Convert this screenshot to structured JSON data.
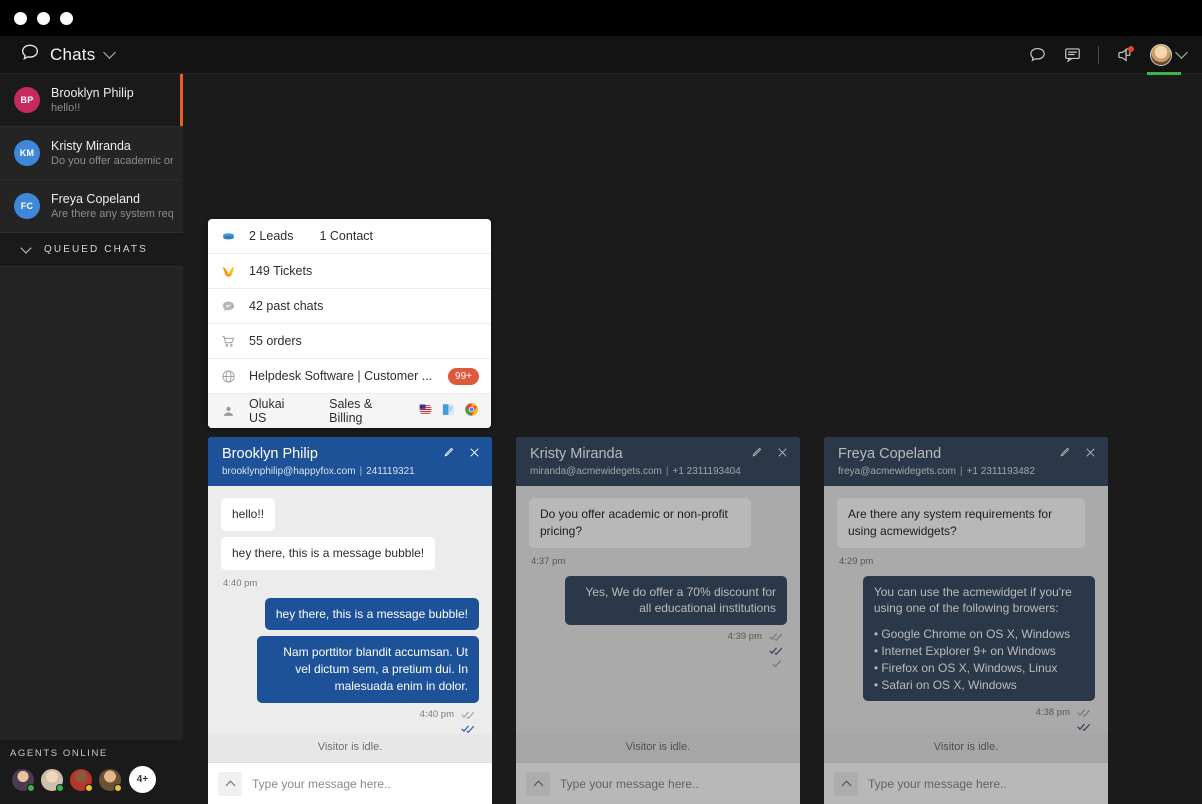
{
  "window": {
    "dots": 3
  },
  "header": {
    "title": "Chats",
    "chat_icon": "speech-bubble-icon",
    "dropdown_icon": "chevron-down-icon",
    "actions": [
      {
        "name": "conversations-icon",
        "glyph": "speech-bubble-outline-icon"
      },
      {
        "name": "messages-icon",
        "glyph": "message-lines-icon"
      },
      {
        "name": "announcements-icon",
        "glyph": "megaphone-icon",
        "has_notification": true
      }
    ],
    "profile": {
      "name": "profile-avatar",
      "status_color": "#3ab54a",
      "dropdown_icon": "chevron-down-icon"
    }
  },
  "sidebar": {
    "chats": [
      {
        "initials": "BP",
        "color": "#c42a5b",
        "name": "Brooklyn Philip",
        "preview": "hello!!",
        "active": true
      },
      {
        "initials": "KM",
        "color": "#3f87d8",
        "name": "Kristy Miranda",
        "preview": "Do you offer academic or ..",
        "active": false
      },
      {
        "initials": "FC",
        "color": "#3f87d8",
        "name": "Freya Copeland",
        "preview": "Are there any system require..",
        "active": false
      }
    ],
    "queued_label": "QUEUED CHATS",
    "agents_label": "AGENTS ONLINE",
    "agents": [
      {
        "name": "agent-avatar-1",
        "status": "#3ab54a"
      },
      {
        "name": "agent-avatar-2",
        "status": "#3ab54a"
      },
      {
        "name": "agent-avatar-3",
        "status": "#e8c32a"
      },
      {
        "name": "agent-avatar-4",
        "status": "#e8c32a"
      }
    ],
    "agents_more": "4+"
  },
  "info_card": {
    "rows": [
      {
        "icon": "leads-icon",
        "text": "2 Leads",
        "text2": "1 Contact"
      },
      {
        "icon": "happyfox-logo-icon",
        "text": "149 Tickets"
      },
      {
        "icon": "chat-bubble-icon",
        "text": "42 past chats"
      },
      {
        "icon": "shopping-cart-icon",
        "text": "55 orders"
      },
      {
        "icon": "globe-icon",
        "text": "Helpdesk Software | Customer ...",
        "badge": "99+"
      },
      {
        "icon": "person-icon",
        "text": "Olukai US",
        "text2": "Sales & Billing",
        "end_icons": [
          "us-flag-icon",
          "windows-device-icon",
          "chrome-browser-icon"
        ]
      }
    ]
  },
  "panels": [
    {
      "name": "Brooklyn Philip",
      "email": "brooklynphilip@happyfox.com",
      "meta": "241119321",
      "dim": false,
      "messages": [
        {
          "dir": "in",
          "text": "hello!!"
        },
        {
          "dir": "in",
          "text": "hey there, this is a message bubble!",
          "time": "4:40 pm"
        },
        {
          "dir": "out",
          "text": "hey there, this is a message bubble!"
        },
        {
          "dir": "out",
          "text": "Nam porttitor blandit accumsan. Ut vel dictum sem, a pretium dui. In malesuada enim in dolor.",
          "time": "4:40 pm"
        }
      ],
      "status": "Visitor is idle.",
      "composer_placeholder": "Type your message here.."
    },
    {
      "name": "Kristy Miranda",
      "email": "miranda@acmewidegets.com",
      "meta": "+1 2311193404",
      "dim": true,
      "messages": [
        {
          "dir": "in",
          "text": "Do you offer academic or non-profit pricing?",
          "time": "4:37 pm"
        },
        {
          "dir": "out",
          "text": "Yes, We do offer a 70% discount for all educational institutions",
          "time": "4:39 pm"
        }
      ],
      "status": "Visitor is idle.",
      "composer_placeholder": "Type your message here.."
    },
    {
      "name": "Freya Copeland",
      "email": "freya@acmewidegets.com",
      "meta": "+1 2311193482",
      "dim": true,
      "messages": [
        {
          "dir": "in",
          "text": "Are there any system requirements for using acmewidgets?",
          "time": "4:29 pm"
        },
        {
          "dir": "out",
          "text": "You can use the acmewidget if you're using one of the following browers:",
          "bullets": [
            "• Google Chrome on OS X, Windows",
            "• Internet Explorer 9+ on Windows",
            "• Firefox on OS X, Windows, Linux",
            "• Safari on OS X, Windows"
          ],
          "time": "4:38 pm"
        }
      ],
      "status": "Visitor is idle.",
      "composer_placeholder": "Type your message here.."
    }
  ],
  "colors": {
    "accent_blue": "#1d5298",
    "accent_orange": "#f15a24",
    "badge_red": "#e0583c",
    "online_green": "#3ab54a",
    "away_yellow": "#e8c32a"
  }
}
